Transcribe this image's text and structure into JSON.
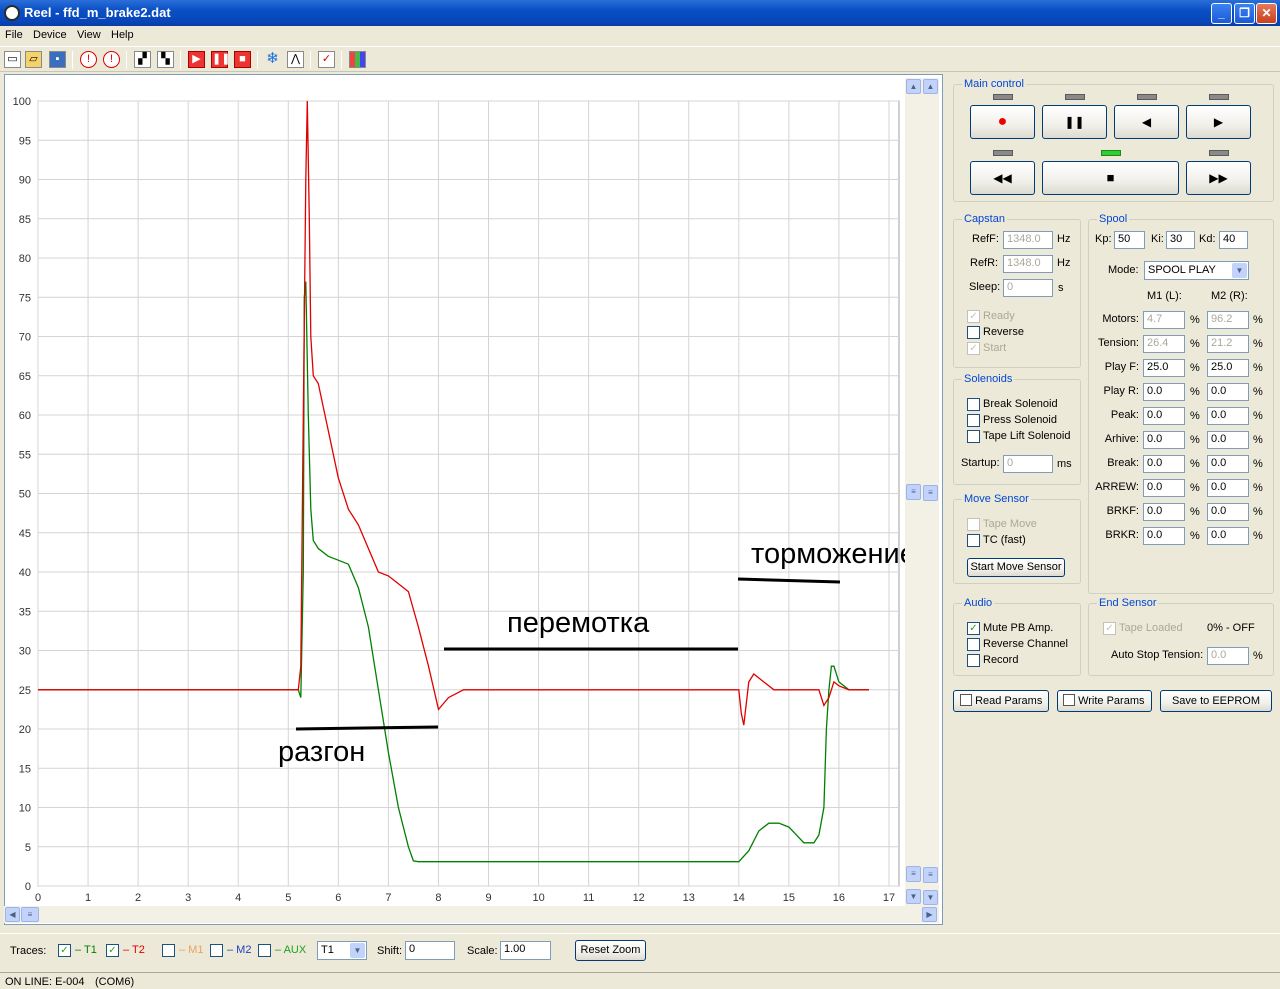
{
  "window": {
    "title": "Reel - ffd_m_brake2.dat"
  },
  "menu": [
    "File",
    "Device",
    "View",
    "Help"
  ],
  "chart_data": {
    "type": "line",
    "xlim": [
      0,
      17.2
    ],
    "ylim": [
      0,
      100
    ],
    "x_ticks": [
      "0",
      "1",
      "2",
      "3",
      "4",
      "5",
      "6",
      "7",
      "8",
      "9",
      "10",
      "11",
      "12",
      "13",
      "14",
      "15",
      "16",
      "17"
    ],
    "y_ticks": [
      "0",
      "5",
      "10",
      "15",
      "20",
      "25",
      "30",
      "35",
      "40",
      "45",
      "50",
      "55",
      "60",
      "65",
      "70",
      "75",
      "80",
      "85",
      "90",
      "95",
      "100"
    ],
    "grid": true,
    "series": [
      {
        "name": "T1",
        "color": "#008000",
        "x": [
          0,
          5.2,
          5.25,
          5.3,
          5.32,
          5.35,
          5.4,
          5.45,
          5.5,
          5.6,
          5.8,
          6.0,
          6.2,
          6.4,
          6.6,
          6.8,
          7.0,
          7.2,
          7.4,
          7.5,
          7.6,
          8.0,
          10,
          12,
          13,
          14.0,
          14.2,
          14.4,
          14.6,
          14.8,
          15.0,
          15.3,
          15.5,
          15.6,
          15.7,
          15.75,
          15.8,
          15.85,
          15.9,
          16.0,
          16.2,
          16.5,
          16.6
        ],
        "y": [
          25,
          25,
          24,
          40,
          75,
          77,
          60,
          48,
          44,
          43,
          42,
          41.5,
          41,
          38,
          33,
          25,
          17,
          10,
          5,
          3.2,
          3.1,
          3.1,
          3.1,
          3.1,
          3.1,
          3.1,
          4.5,
          7,
          8,
          8,
          7.5,
          5.5,
          5.5,
          6.5,
          10,
          20,
          25,
          28,
          28,
          26,
          25,
          25,
          25
        ]
      },
      {
        "name": "T2",
        "color": "#e00000",
        "x": [
          0,
          5.2,
          5.25,
          5.3,
          5.35,
          5.38,
          5.42,
          5.45,
          5.5,
          5.6,
          5.8,
          6.0,
          6.2,
          6.4,
          6.6,
          6.8,
          7.0,
          7.2,
          7.4,
          7.6,
          7.8,
          8.0,
          8.2,
          8.5,
          10,
          12,
          14.0,
          14.05,
          14.1,
          14.2,
          14.3,
          14.5,
          14.7,
          14.9,
          15.2,
          15.6,
          15.7,
          15.8,
          15.9,
          16.0,
          16.2,
          16.6
        ],
        "y": [
          25,
          25,
          28,
          60,
          90,
          100,
          85,
          70,
          65,
          64,
          58,
          52,
          48,
          46,
          43,
          40,
          39.5,
          38.5,
          37.5,
          33,
          28,
          22.5,
          24,
          25,
          25,
          25,
          25,
          22,
          20.5,
          26,
          27,
          26,
          25,
          25,
          25,
          25,
          23,
          24,
          26,
          25.5,
          25,
          25
        ]
      }
    ],
    "annotations": [
      "разгон",
      "перемотка",
      "торможение"
    ]
  },
  "main_control": {
    "caption": "Main control"
  },
  "capstan": {
    "caption": "Capstan",
    "ref_f_label": "RefF:",
    "ref_f": "1348.0",
    "ref_f_unit": "Hz",
    "ref_r_label": "RefR:",
    "ref_r": "1348.0",
    "ref_r_unit": "Hz",
    "sleep_label": "Sleep:",
    "sleep": "0",
    "sleep_unit": "s",
    "ready": "Ready",
    "reverse": "Reverse",
    "start": "Start"
  },
  "solenoids": {
    "caption": "Solenoids",
    "break": "Break Solenoid",
    "press": "Press Solenoid",
    "tape_lift": "Tape Lift Solenoid",
    "startup_label": "Startup:",
    "startup": "0",
    "startup_unit": "ms"
  },
  "move_sensor": {
    "caption": "Move Sensor",
    "tape_move": "Tape Move",
    "tc_fast": "TC (fast)",
    "start_button": "Start Move Sensor"
  },
  "audio": {
    "caption": "Audio",
    "mute": "Mute PB Amp.",
    "reverse_channel": "Reverse Channel",
    "record": "Record"
  },
  "spool": {
    "caption": "Spool",
    "kp_label": "Kp:",
    "kp": "50",
    "ki_label": "Ki:",
    "ki": "30",
    "kd_label": "Kd:",
    "kd": "40",
    "mode_label": "Mode:",
    "mode": "SPOOL PLAY",
    "m1_header": "M1 (L):",
    "m2_header": "M2 (R):",
    "rows": [
      {
        "label": "Motors:",
        "m1": "4.7",
        "m2": "96.2"
      },
      {
        "label": "Tension:",
        "m1": "26.4",
        "m2": "21.2"
      },
      {
        "label": "Play F:",
        "m1": "25.0",
        "m2": "25.0"
      },
      {
        "label": "Play R:",
        "m1": "0.0",
        "m2": "0.0"
      },
      {
        "label": "Peak:",
        "m1": "0.0",
        "m2": "0.0"
      },
      {
        "label": "Arhive:",
        "m1": "0.0",
        "m2": "0.0"
      },
      {
        "label": "Break:",
        "m1": "0.0",
        "m2": "0.0"
      },
      {
        "label": "ARREW:",
        "m1": "0.0",
        "m2": "0.0"
      },
      {
        "label": "BRKF:",
        "m1": "0.0",
        "m2": "0.0"
      },
      {
        "label": "BRKR:",
        "m1": "0.0",
        "m2": "0.0"
      }
    ],
    "pct": "%"
  },
  "end_sensor": {
    "caption": "End Sensor",
    "tape_loaded": "Tape Loaded",
    "status": "0% - OFF",
    "auto_stop_label": "Auto Stop Tension:",
    "auto_stop": "0.0",
    "pct": "%"
  },
  "buttons": {
    "read": "Read Params",
    "write": "Write Params",
    "save": "Save to EEPROM"
  },
  "traces": {
    "label": "Traces:",
    "t1": "– T1",
    "t2": "– T2",
    "m1": "– M1",
    "m2": "– M2",
    "aux": "– AUX",
    "select": "T1",
    "shift_label": "Shift:",
    "shift": "0",
    "scale_label": "Scale:",
    "scale": "1.00",
    "reset_zoom": "Reset Zoom"
  },
  "status": {
    "online": "ON LINE: E-004",
    "port": "(COM6)"
  }
}
